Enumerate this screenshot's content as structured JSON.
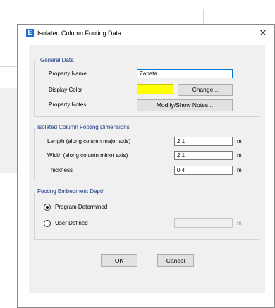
{
  "window": {
    "title": "Isolated Column Footing Data",
    "icon_letter": "E",
    "close_glyph": "✕"
  },
  "general_data": {
    "legend": "General Data",
    "property_name_label": "Property Name",
    "property_name_value": "Zapata",
    "display_color_label": "Display Color",
    "display_color": "#ffff00",
    "change_button": "Change...",
    "property_notes_label": "Property Notes",
    "notes_button": "Modify/Show Notes..."
  },
  "dimensions": {
    "legend": "Isolated Column Footing Dimensions",
    "rows": [
      {
        "label": "Length (along column major axis)",
        "value": "2,1",
        "unit": "m"
      },
      {
        "label": "Width (along column minor axis)",
        "value": "2,1",
        "unit": "m"
      },
      {
        "label": "Thickness",
        "value": "0,4",
        "unit": "m"
      }
    ]
  },
  "embedment": {
    "legend": "Footing Embedment Depth",
    "option_program": "Program Determined",
    "option_user": "User Defined",
    "selected": "program",
    "user_value": "",
    "unit": "m"
  },
  "buttons": {
    "ok": "OK",
    "cancel": "Cancel"
  }
}
